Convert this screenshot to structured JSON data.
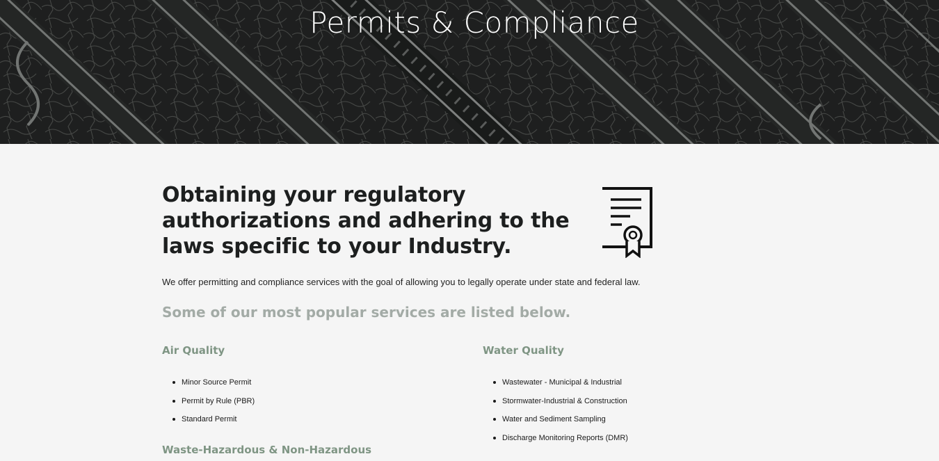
{
  "hero": {
    "title": "Permits & Compliance",
    "background_image": "aerial view of water treatment channels",
    "overlay_color": "#2a2c2b"
  },
  "main": {
    "headline": "Obtaining your regulatory authorizations and adhering to the laws specific to your Industry.",
    "icon": "certificate-icon",
    "intro": "We offer permitting and compliance services with the goal of allowing you to legally operate under state and federal law.",
    "services_heading": "Some of our most popular services are listed below."
  },
  "services": {
    "air_quality": {
      "title": "Air Quality",
      "items": [
        "Minor Source Permit",
        "Permit by Rule (PBR)",
        "Standard Permit"
      ]
    },
    "water_quality": {
      "title": "Water Quality",
      "items": [
        "Wastewater - Municipal & Industrial",
        "Stormwater-Industrial & Construction",
        "Water and Sediment Sampling",
        "Discharge Monitoring Reports (DMR)"
      ]
    },
    "waste": {
      "title": "Waste-Hazardous & Non-Hazardous"
    }
  },
  "colors": {
    "page_background": "#f5f5f5",
    "heading_text": "#1d1f1f",
    "subheading_gray": "#a3aba6",
    "section_green": "#7f9584"
  }
}
